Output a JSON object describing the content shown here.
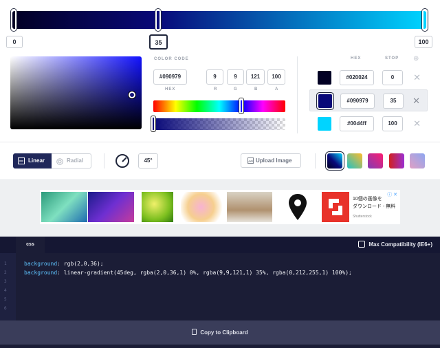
{
  "gradient": {
    "stops": [
      {
        "stop": "0",
        "hex": "#020024",
        "color": "#020024"
      },
      {
        "stop": "35",
        "hex": "#090979",
        "color": "#090979"
      },
      {
        "stop": "100",
        "hex": "#00d4ff",
        "color": "#00d4ff"
      }
    ],
    "active_stop_index": 1
  },
  "color_code": {
    "label": "COLOR CODE",
    "hex_value": "#090979",
    "r": "9",
    "g": "9",
    "b": "121",
    "a": "100",
    "hex_label": "HEX",
    "r_label": "R",
    "g_label": "G",
    "b_label": "B",
    "a_label": "A"
  },
  "stops_table": {
    "hex_header": "HEX",
    "stop_header": "STOP",
    "add_icon": "plus-icon",
    "remove_symbol": "✕"
  },
  "toolbar": {
    "linear_label": "Linear",
    "radial_label": "Radial",
    "active_mode": "linear",
    "angle": "45°",
    "upload_label": "Upload Image",
    "presets": [
      {
        "name": "blue-dark",
        "active": true
      },
      {
        "name": "green-yellow",
        "active": false
      },
      {
        "name": "purple-pink",
        "active": false
      },
      {
        "name": "red-purple",
        "active": false
      },
      {
        "name": "lilac",
        "active": false
      }
    ]
  },
  "ad": {
    "adchoices": "ⓘ ✕",
    "text_line1": "10個の画像を",
    "text_line2": "ダウンロード - 無料",
    "source": "Shutterstock"
  },
  "editor": {
    "tab_label": "css",
    "compat_label": "Max Compatibility (IE6+)",
    "line_numbers": [
      "1",
      "2",
      "3",
      "4",
      "5",
      "6"
    ],
    "line1_prop": "background",
    "line1_value": ": rgb(2,0,36);",
    "line2_prop": "background",
    "line2_value": ": linear-gradient(45deg, rgba(2,0,36,1) 0%, rgba(9,9,121,1) 35%, rgba(0,212,255,1) 100%);",
    "copy_label": "Copy to Clipboard"
  }
}
